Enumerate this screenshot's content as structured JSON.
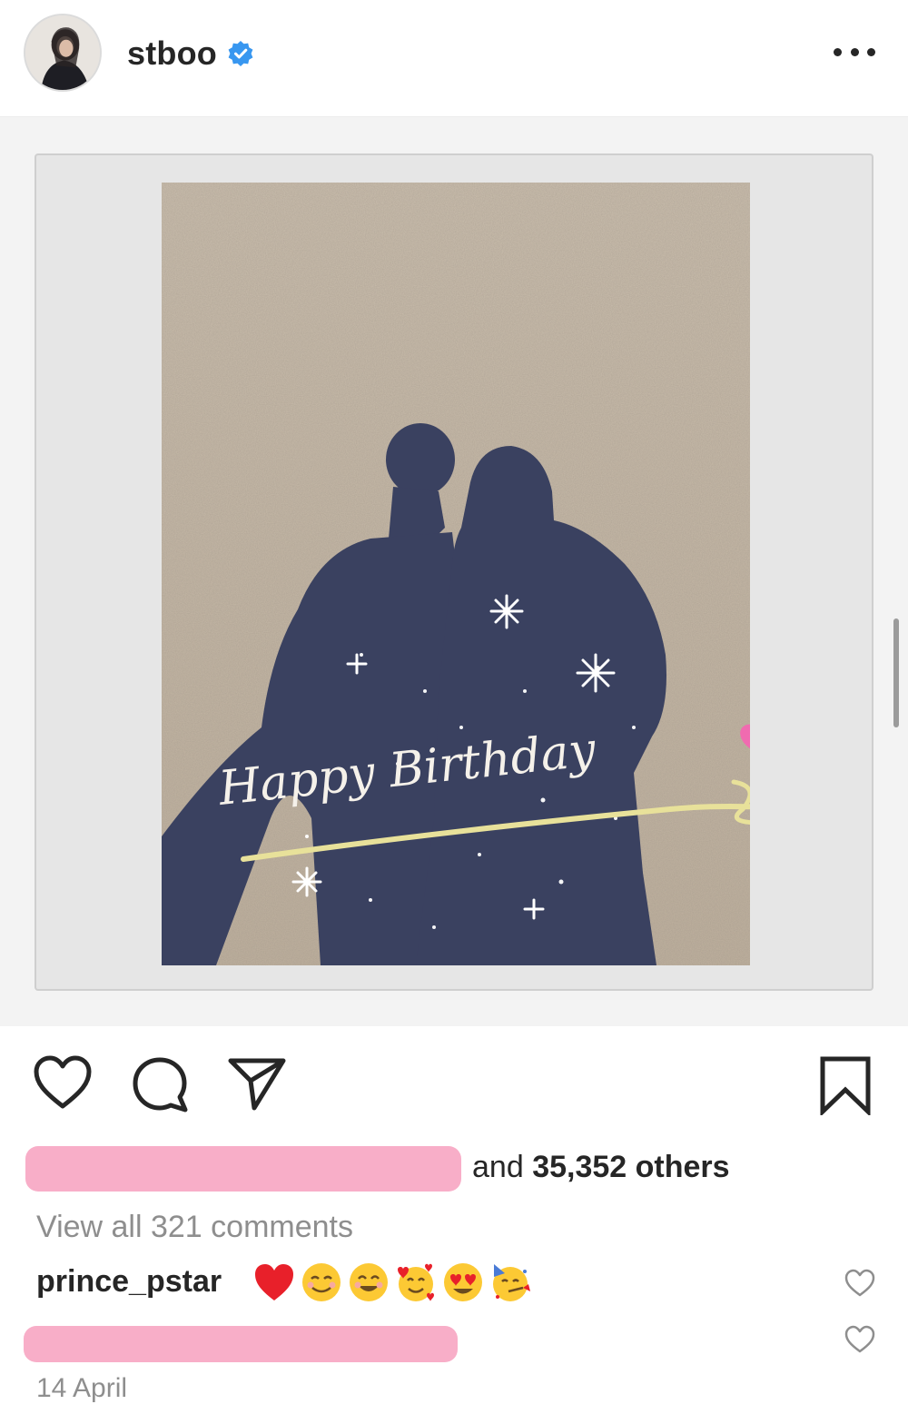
{
  "header": {
    "username": "stboo",
    "verified_icon": "verified-badge-icon",
    "more_icon": "more-options-icon"
  },
  "post": {
    "image_caption_overlay": "Happy Birthday",
    "actions": {
      "like_icon": "heart-icon",
      "comment_icon": "comment-bubble-icon",
      "share_icon": "paper-plane-icon",
      "save_icon": "bookmark-icon"
    },
    "likes": {
      "prefix": "and ",
      "count": "35,352 others"
    },
    "view_all_comments": "View all 321 comments",
    "comments": [
      {
        "username": "prince_pstar",
        "emojis": [
          "red-heart",
          "smiling-face",
          "smiling-face-with-smiling-eyes",
          "smiling-face-with-hearts",
          "heart-eyes",
          "partying-face"
        ]
      }
    ],
    "date": "14 April"
  },
  "colors": {
    "redaction": "#f8aec8",
    "verified": "#3897f0",
    "text_primary": "#262626",
    "text_secondary": "#8e8e8e"
  }
}
